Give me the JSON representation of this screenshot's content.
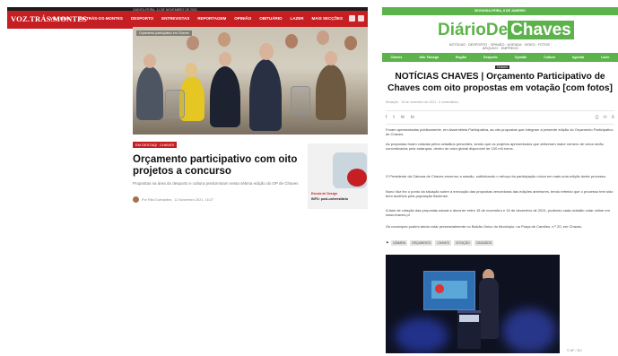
{
  "left": {
    "logo": "VOZ.TRÁS.MONTES",
    "top_strip": "QUINTA-FEIRA, 11 DE NOVEMBRO DE 2021",
    "menu": [
      "VILA REAL",
      "DE TRÁS-OS-MONTES",
      "DESPORTO",
      "ENTREVISTAS",
      "REPORTAGEM",
      "OPINIÃO",
      "OBITUÁRIO",
      "LAZER",
      "MAIS SECÇÕES"
    ],
    "photo_caption": "Orçamento participativo em Chaves",
    "tags": [
      "EM DESTAQUE",
      "CHAVES"
    ],
    "headline": "Orçamento participativo com oito projetos a concurso",
    "lead": "Propostas na área do desporto e cultura predominam nesta sétima edição do OP de Chaves",
    "author": "Por Rita Guimarães",
    "date": "11 Novembro 2021, 16:27",
    "ad": {
      "title": "Escola de Design",
      "subtitle": "INFO: post-universitário"
    }
  },
  "right": {
    "top_bar": "SEGUNDA-FEIRA, 8 DE JANEIRO",
    "logo_a": "Diário",
    "logo_b": "De",
    "logo_c": "Chaves",
    "tagline": "NOTÍCIAS · DESPORTO · OPINIÃO · AGENDA · VIDEO · FOTOS · ARQUIVO · EMPREGO",
    "nav": [
      "Chaves",
      "Alto Tâmega",
      "Região",
      "Desporto",
      "Opinião",
      "Cultura",
      "Agenda",
      "Lazer"
    ],
    "category": "Chaves",
    "headline": "NOTÍCIAS CHAVES | Orçamento Participativo de Chaves com oito propostas em votação [com fotos]",
    "meta": "Redação · 16 de novembro de 2021 · 0 comentários",
    "share": [
      "f",
      "t",
      "✉",
      "in"
    ],
    "tools": [
      "⎙",
      "✉",
      "A"
    ],
    "paragraphs": [
      "Foram apresentadas publicamente, em Assembleia Participativa, as oito propostas que integram a presente edição do Orçamento Participativo de Chaves.",
      "As propostas foram votadas pelos cidadãos presentes, sendo que os projetos apresentados que obtiveram maior número de votos serão concretizados pela autarquia, dentro do valor global disponível de 100 mil euros.",
      "O Presidente da Câmara de Chaves encerrou a sessão, sublinhando o reforço da participação cívica em mais uma edição deste processo.",
      "Nuno Vaz fez o ponto da situação sobre a execução das propostas vencedoras das edições anteriores, tendo referido que o processo tem sido bem acolhido pela população flaviense.",
      "A fase de votação das propostas estará a decorrer entre 15 de novembro e 15 de dezembro de 2021, podendo cada cidadão votar online em www.chaves.pt",
      "Os munícipes podem ainda votar presencialmente no Balcão Único do Município, na Praça de Camões, n.º 20, em Chaves."
    ],
    "tags": [
      "CÂMARA",
      "ORÇAMENTO",
      "CHAVES",
      "VOTAÇÃO",
      "CIDADÃOS"
    ],
    "credit": "© AF / DC"
  }
}
